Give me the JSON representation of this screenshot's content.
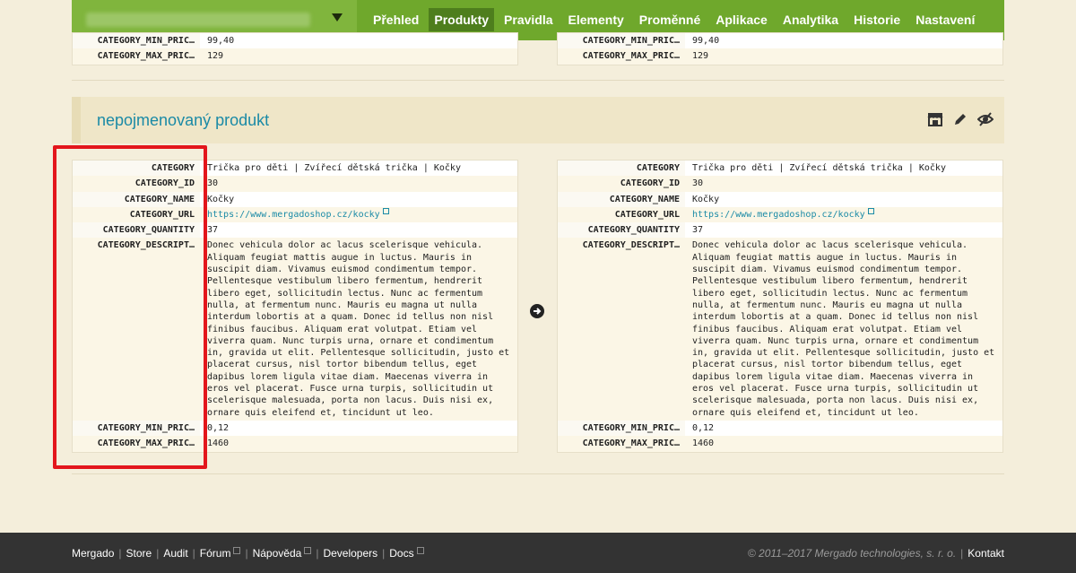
{
  "nav": {
    "items": [
      "Přehled",
      "Produkty",
      "Pravidla",
      "Elementy",
      "Proměnné",
      "Aplikace",
      "Analytika",
      "Historie",
      "Nastavení"
    ],
    "active": "Produkty"
  },
  "top_rows": {
    "left": [
      {
        "key": "CATEGORY_MIN_PRIC…",
        "value": "99,40"
      },
      {
        "key": "CATEGORY_MAX_PRIC…",
        "value": "129"
      }
    ],
    "right": [
      {
        "key": "CATEGORY_MIN_PRIC…",
        "value": "99,40"
      },
      {
        "key": "CATEGORY_MAX_PRIC…",
        "value": "129"
      }
    ]
  },
  "product": {
    "title": "nepojmenovaný produkt",
    "left": [
      {
        "key": "CATEGORY",
        "value": "Trička pro děti | Zvířecí dětská trička | Kočky"
      },
      {
        "key": "CATEGORY_ID",
        "value": "30"
      },
      {
        "key": "CATEGORY_NAME",
        "value": "Kočky"
      },
      {
        "key": "CATEGORY_URL",
        "value": "https://www.mergadoshop.cz/kocky"
      },
      {
        "key": "CATEGORY_QUANTITY",
        "value": "37"
      },
      {
        "key": "CATEGORY_DESCRIPT…",
        "value": "Donec vehicula dolor ac lacus scelerisque vehicula. Aliquam feugiat mattis augue in luctus. Mauris in suscipit diam. Vivamus euismod condimentum tempor. Pellentesque vestibulum libero fermentum, hendrerit libero eget, sollicitudin lectus. Nunc ac fermentum nulla, at fermentum nunc. Mauris eu magna ut nulla interdum lobortis at a quam. Donec id tellus non nisl finibus faucibus. Aliquam erat volutpat. Etiam vel viverra quam. Nunc turpis urna, ornare et condimentum in, gravida ut elit. Pellentesque sollicitudin, justo et placerat cursus, nisl tortor bibendum tellus, eget dapibus lorem ligula vitae diam. Maecenas viverra in eros vel placerat. Fusce urna turpis, sollicitudin ut scelerisque malesuada, porta non lacus. Duis nisi ex, ornare quis eleifend et, tincidunt ut leo."
      },
      {
        "key": "CATEGORY_MIN_PRIC…",
        "value": "0,12"
      },
      {
        "key": "CATEGORY_MAX_PRIC…",
        "value": "1460"
      }
    ],
    "right": [
      {
        "key": "CATEGORY",
        "value": "Trička pro děti | Zvířecí dětská trička | Kočky"
      },
      {
        "key": "CATEGORY_ID",
        "value": "30"
      },
      {
        "key": "CATEGORY_NAME",
        "value": "Kočky"
      },
      {
        "key": "CATEGORY_URL",
        "value": "https://www.mergadoshop.cz/kocky"
      },
      {
        "key": "CATEGORY_QUANTITY",
        "value": "37"
      },
      {
        "key": "CATEGORY_DESCRIPT…",
        "value": "Donec vehicula dolor ac lacus scelerisque vehicula. Aliquam feugiat mattis augue in luctus. Mauris in suscipit diam. Vivamus euismod condimentum tempor. Pellentesque vestibulum libero fermentum, hendrerit libero eget, sollicitudin lectus. Nunc ac fermentum nulla, at fermentum nunc. Mauris eu magna ut nulla interdum lobortis at a quam. Donec id tellus non nisl finibus faucibus. Aliquam erat volutpat. Etiam vel viverra quam. Nunc turpis urna, ornare et condimentum in, gravida ut elit. Pellentesque sollicitudin, justo et placerat cursus, nisl tortor bibendum tellus, eget dapibus lorem ligula vitae diam. Maecenas viverra in eros vel placerat. Fusce urna turpis, sollicitudin ut scelerisque malesuada, porta non lacus. Duis nisi ex, ornare quis eleifend et, tincidunt ut leo."
      },
      {
        "key": "CATEGORY_MIN_PRIC…",
        "value": "0,12"
      },
      {
        "key": "CATEGORY_MAX_PRIC…",
        "value": "1460"
      }
    ]
  },
  "footer": {
    "links": [
      "Mergado",
      "Store",
      "Audit",
      "Fórum",
      "Nápověda",
      "Developers",
      "Docs"
    ],
    "copyright": "© 2011–2017 Mergado technologies, s. r. o.",
    "contact": "Kontakt"
  },
  "colors": {
    "nav_bg": "#6fa82c",
    "link": "#1a8aa6",
    "highlight": "#e3161c"
  }
}
